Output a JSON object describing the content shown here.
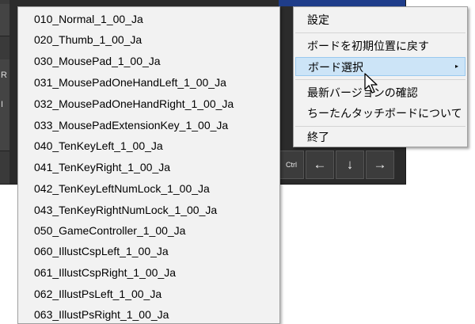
{
  "keyboard": {
    "left_keys": [
      "",
      "R",
      "I",
      ""
    ],
    "ctrl_label": "Ctrl",
    "arrows": [
      "←",
      "↓",
      "→"
    ]
  },
  "context_menu": {
    "items": [
      {
        "label": "設定"
      },
      {
        "label": "ボードを初期位置に戻す"
      },
      {
        "label": "ボード選択",
        "submenu_arrow": "▸"
      },
      {
        "label": "最新バージョンの確認"
      },
      {
        "label": "ちーたんタッチボードについて"
      },
      {
        "label": "終了"
      }
    ],
    "selected_index": 2
  },
  "board_list": [
    "010_Normal_1_00_Ja",
    "020_Thumb_1_00_Ja",
    "030_MousePad_1_00_Ja",
    "031_MousePadOneHandLeft_1_00_Ja",
    "032_MousePadOneHandRight_1_00_Ja",
    "033_MousePadExtensionKey_1_00_Ja",
    "040_TenKeyLeft_1_00_Ja",
    "041_TenKeyRight_1_00_Ja",
    "042_TenKeyLeftNumLock_1_00_Ja",
    "043_TenKeyRightNumLock_1_00_Ja",
    "050_GameController_1_00_Ja",
    "060_IllustCspLeft_1_00_Ja",
    "061_IllustCspRight_1_00_Ja",
    "062_IllustPsLeft_1_00_Ja",
    "063_IllustPsRight_1_00_Ja"
  ]
}
